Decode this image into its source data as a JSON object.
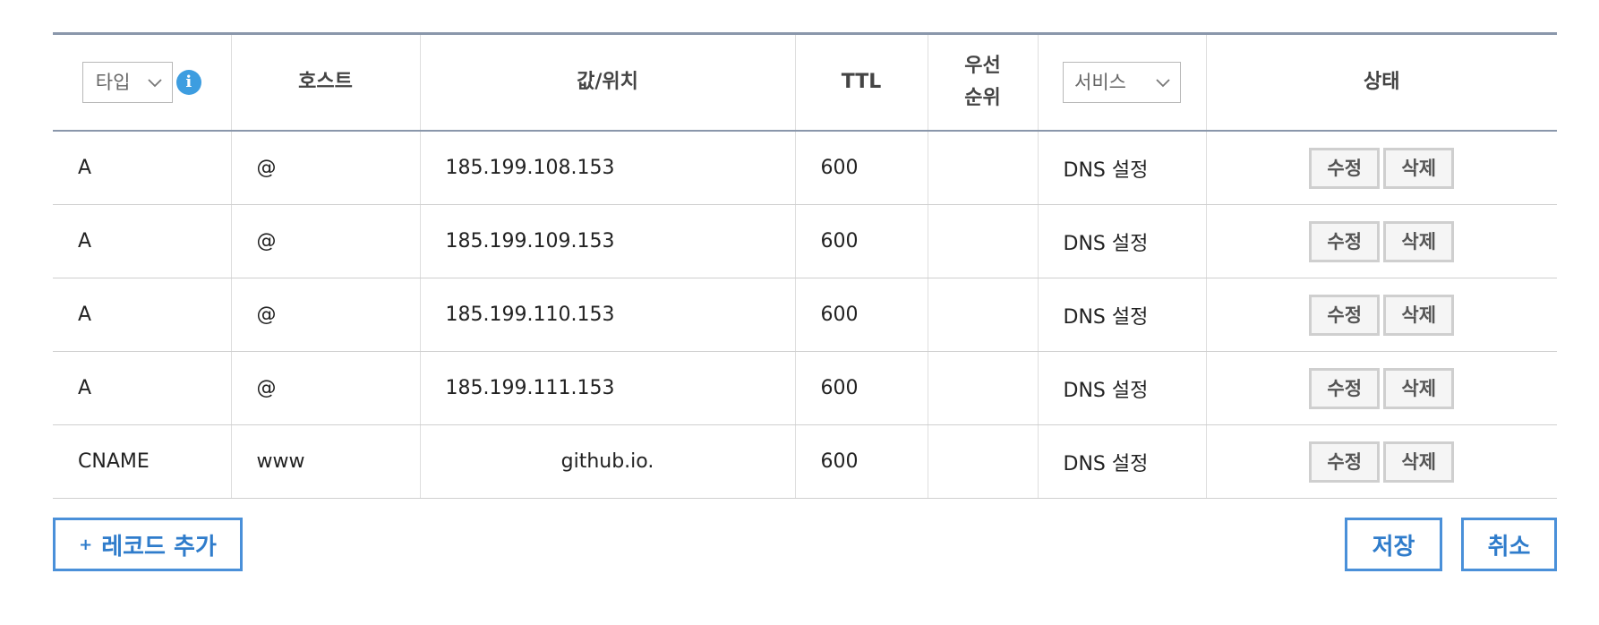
{
  "header": {
    "type_select": "타입",
    "host": "호스트",
    "value": "값/위치",
    "ttl": "TTL",
    "priority_line1": "우선",
    "priority_line2": "순위",
    "service_select": "서비스",
    "status": "상태"
  },
  "records": [
    {
      "type": "A",
      "host": "@",
      "value": "185.199.108.153",
      "ttl": "600",
      "priority": "",
      "service": "DNS 설정",
      "edit": "수정",
      "delete": "삭제"
    },
    {
      "type": "A",
      "host": "@",
      "value": "185.199.109.153",
      "ttl": "600",
      "priority": "",
      "service": "DNS 설정",
      "edit": "수정",
      "delete": "삭제"
    },
    {
      "type": "A",
      "host": "@",
      "value": "185.199.110.153",
      "ttl": "600",
      "priority": "",
      "service": "DNS 설정",
      "edit": "수정",
      "delete": "삭제"
    },
    {
      "type": "A",
      "host": "@",
      "value": "185.199.111.153",
      "ttl": "600",
      "priority": "",
      "service": "DNS 설정",
      "edit": "수정",
      "delete": "삭제"
    },
    {
      "type": "CNAME",
      "host": "www",
      "value": "github.io.",
      "ttl": "600",
      "priority": "",
      "service": "DNS 설정",
      "edit": "수정",
      "delete": "삭제"
    }
  ],
  "footer": {
    "add_plus": "+",
    "add_record": "레코드 추가",
    "save": "저장",
    "cancel": "취소"
  },
  "icons": {
    "info": "info-icon",
    "dropdown": "chevron-down-icon"
  },
  "colors": {
    "accent": "#4a90d9",
    "info": "#3d9de0",
    "header_rule": "#8a97ab"
  }
}
